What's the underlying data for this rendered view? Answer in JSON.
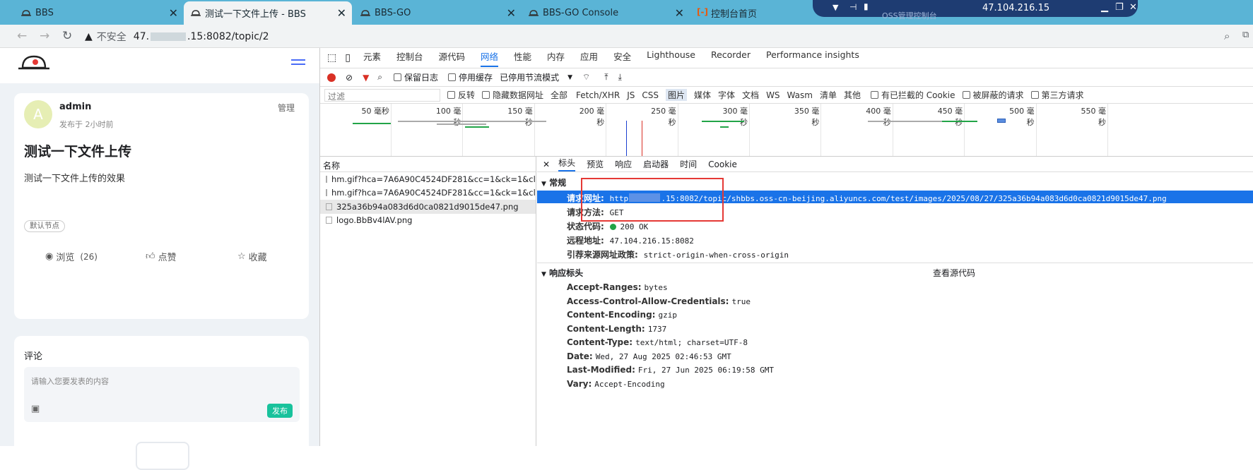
{
  "tabs": [
    {
      "label": "BBS"
    },
    {
      "label": "测试一下文件上传 - BBS"
    },
    {
      "label": "BBS-GO"
    },
    {
      "label": "BBS-GO Console"
    },
    {
      "label": "控制台首页"
    }
  ],
  "remote": {
    "title": "OSS管理控制台",
    "ip": "47.104.216.15"
  },
  "address": {
    "insecure": "不安全",
    "url_prefix": "47.",
    "url_suffix": ".15:8082/topic/2"
  },
  "post": {
    "author": "admin",
    "avatar_letter": "A",
    "time": "发布于 2小时前",
    "manage": "管理",
    "title": "测试一下文件上传",
    "body": "测试一下文件上传的效果",
    "tag": "默认节点",
    "views_label": "浏览",
    "views_count": "(26)",
    "like": "点赞",
    "fav": "收藏"
  },
  "comment": {
    "title": "评论",
    "placeholder": "请输入您要发表的内容",
    "submit": "发布"
  },
  "devtools": {
    "tabs": [
      "元素",
      "控制台",
      "源代码",
      "网络",
      "性能",
      "内存",
      "应用",
      "安全",
      "Lighthouse",
      "Recorder",
      "Performance insights"
    ],
    "active_tab": "网络",
    "toolbar": {
      "preserve_log": "保留日志",
      "disable_cache": "停用缓存",
      "throttle": "已停用节流模式"
    },
    "filter": {
      "placeholder": "过滤",
      "invert": "反转",
      "hide_data": "隐藏数据网址",
      "all": "全部",
      "types": [
        "Fetch/XHR",
        "JS",
        "CSS",
        "图片",
        "媒体",
        "字体",
        "文档",
        "WS",
        "Wasm",
        "清单",
        "其他"
      ],
      "active_type": "图片",
      "blocked_cookies": "有已拦截的 Cookie",
      "blocked_requests": "被屏蔽的请求",
      "third_party": "第三方请求"
    },
    "timeline": [
      "50 毫秒",
      "100 毫秒",
      "150 毫秒",
      "200 毫秒",
      "250 毫秒",
      "300 毫秒",
      "350 毫秒",
      "400 毫秒",
      "450 毫秒",
      "500 毫秒",
      "550 毫秒"
    ],
    "requests": {
      "header": "名称",
      "items": [
        "hm.gif?hca=7A6A90C4524DF281&cc=1&ck=1&cl=24-bit...",
        "hm.gif?hca=7A6A90C4524DF281&cc=1&ck=1&cl=24-bit...",
        "325a36b94a083d6d0ca0821d9015de47.png",
        "logo.BbBv4lAV.png"
      ]
    },
    "detail_tabs": [
      "标头",
      "预览",
      "响应",
      "启动器",
      "时间",
      "Cookie"
    ],
    "general": {
      "title": "常规",
      "url_label": "请求网址:",
      "url": "http://47.       .15:8082/topic/shbbs.oss-cn-beijing.aliyuncs.com/test/images/2025/08/27/325a36b94a083d6d0ca0821d9015de47.png",
      "method_label": "请求方法:",
      "method": "GET",
      "status_label": "状态代码:",
      "status": "200 OK",
      "remote_label": "远程地址:",
      "remote": "47.104.216.15:8082",
      "referrer_label": "引荐来源网址政策:",
      "referrer": "strict-origin-when-cross-origin"
    },
    "response_headers": {
      "title": "响应标头",
      "view_source": "查看源代码",
      "items": [
        {
          "k": "Accept-Ranges:",
          "v": "bytes"
        },
        {
          "k": "Access-Control-Allow-Credentials:",
          "v": "true"
        },
        {
          "k": "Content-Encoding:",
          "v": "gzip"
        },
        {
          "k": "Content-Length:",
          "v": "1737"
        },
        {
          "k": "Content-Type:",
          "v": "text/html; charset=UTF-8"
        },
        {
          "k": "Date:",
          "v": "Wed, 27 Aug 2025 02:46:53 GMT"
        },
        {
          "k": "Last-Modified:",
          "v": "Fri, 27 Jun 2025 06:19:58 GMT"
        },
        {
          "k": "Vary:",
          "v": "Accept-Encoding"
        }
      ]
    }
  }
}
